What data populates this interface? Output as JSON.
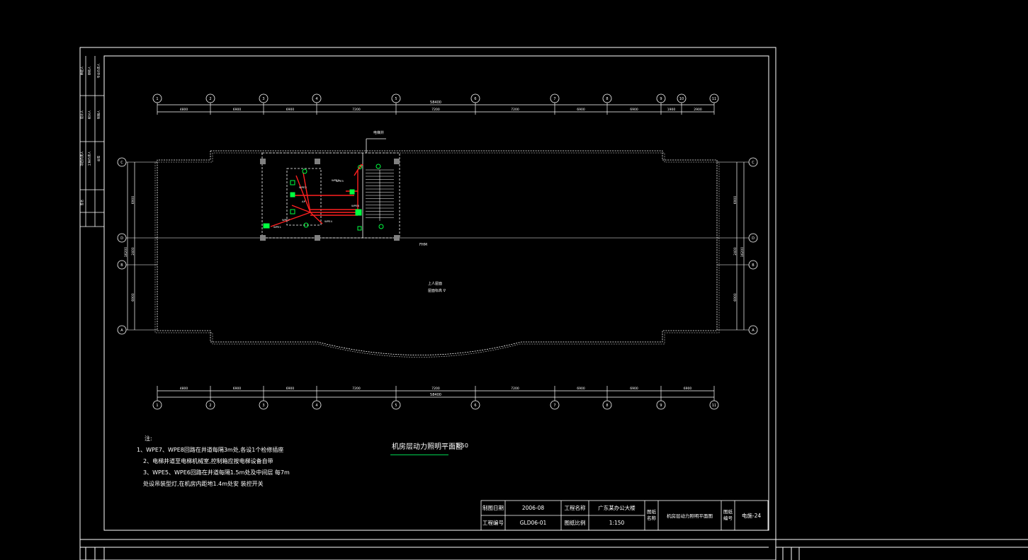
{
  "axes": {
    "top_labels": [
      "1",
      "2",
      "3",
      "4",
      "5",
      "6",
      "7",
      "8",
      "9",
      "10",
      "11"
    ],
    "top_dims": [
      "4800",
      "6900",
      "6900",
      "7200",
      "7200",
      "7200",
      "6900",
      "6900",
      "1900",
      "2900"
    ],
    "top_total": "58400",
    "bottom_labels": [
      "1",
      "2",
      "3",
      "4",
      "5",
      "6",
      "7",
      "8",
      "9",
      "11"
    ],
    "bottom_dims": [
      "4800",
      "6900",
      "6900",
      "7200",
      "7200",
      "7200",
      "6900",
      "6900",
      "6900"
    ],
    "bottom_total": "58400",
    "left_labels": [
      "C",
      "D",
      "B",
      "A"
    ],
    "left_dims": [
      "6900",
      "2400",
      "6900"
    ],
    "left_total": "16200",
    "right_labels": [
      "C",
      "D",
      "B",
      "A"
    ],
    "right_dims": [
      "6900",
      "2400",
      "6900"
    ],
    "right_total": "16200"
  },
  "plan": {
    "roof_label": "上人屋面",
    "roof_level": "屋面标高 ∇",
    "corridor_label": "FHM",
    "stair_tag": "电梯井",
    "panels": [
      "WPE1",
      "WPE2",
      "WPE3",
      "WPE4",
      "WPE5",
      "WPE6",
      "WPE7",
      "AP"
    ]
  },
  "notes": {
    "heading": "注:",
    "lines": [
      "1、WPE7、WPE8回路在井道每隔3m处,各设1个检修插座",
      "2、电梯井道至电梯机械室,控制箱应按电梯设备自带",
      "3、WPE5、WPE6回路在井道每隔1.5m处及中间层       每7m",
      "    处设吊装型灯,在机房内距地1.4m处安    装控开关"
    ]
  },
  "drawing_title": "机房层动力照明平面图",
  "drawing_scale": "1:50",
  "title_block": {
    "date_label": "制图日期",
    "date_value": "2006-08",
    "proj_label": "工程名称",
    "proj_value": "广东某办公大楼",
    "no_label": "工程编号",
    "no_value": "GLD06-01",
    "scale_label": "图纸比例",
    "scale_value": "1:150",
    "name_label": "图纸名称",
    "name_value": "机房层动力照明平面图",
    "code_label": "图纸编号",
    "code_value": "电施-24"
  },
  "side_strip": [
    "审定人",
    "审核人",
    "专业负责人",
    "设计人",
    "校对人",
    "制图人",
    "项目负责人",
    "工程负责人",
    "会签",
    "签名"
  ],
  "colors": {
    "line": "#ffffff",
    "power": "#ff2020",
    "device": "#00ff40",
    "wall_fill": "#808080"
  }
}
